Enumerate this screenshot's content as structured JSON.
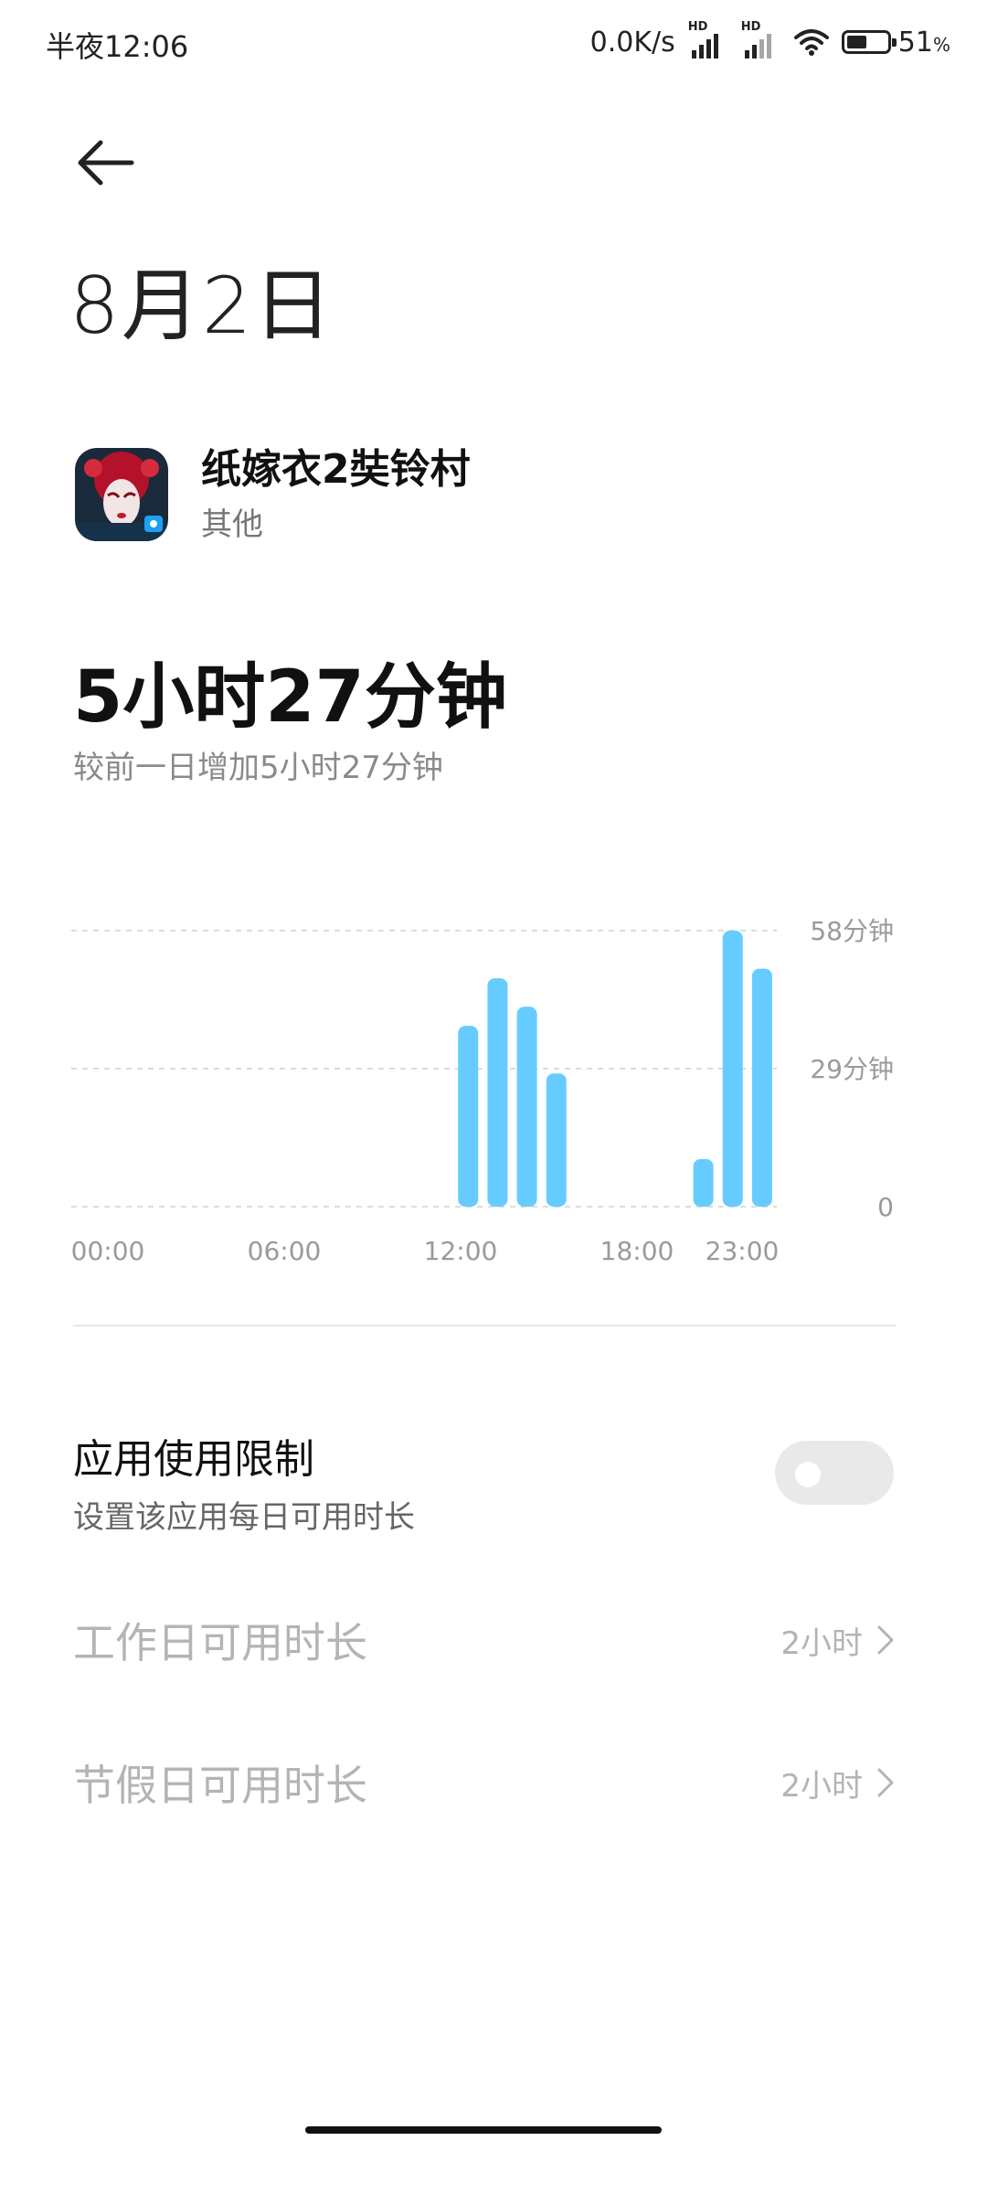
{
  "status_bar": {
    "time": "半夜12:06",
    "net_speed": "0.0K/s",
    "sim1_tag": "HD",
    "sim2_tag": "HD",
    "battery_pct": "51",
    "battery_unit": "%",
    "battery_level": 0.51
  },
  "header": {
    "date_title": "8月2日"
  },
  "app": {
    "name": "纸嫁衣2奘铃村",
    "category": "其他"
  },
  "usage": {
    "total": "5小时27分钟",
    "compare": "较前一日增加5小时27分钟"
  },
  "chart_data": {
    "type": "bar",
    "x_labels": [
      "00:00",
      "06:00",
      "12:00",
      "18:00",
      "23:00"
    ],
    "y_ticks": [
      "58分钟",
      "29分钟",
      "0"
    ],
    "ylim": [
      0,
      58
    ],
    "grid": true,
    "bar_color": "#66CCFF",
    "hours": [
      0,
      1,
      2,
      3,
      4,
      5,
      6,
      7,
      8,
      9,
      10,
      11,
      12,
      13,
      14,
      15,
      16,
      17,
      18,
      19,
      20,
      21,
      22,
      23
    ],
    "values": [
      0,
      0,
      0,
      0,
      0,
      0,
      0,
      0,
      0,
      0,
      0,
      0,
      0,
      38,
      48,
      42,
      28,
      0,
      0,
      0,
      0,
      10,
      58,
      50,
      50
    ]
  },
  "limit": {
    "title": "应用使用限制",
    "subtitle": "设置该应用每日可用时长",
    "enabled": false
  },
  "rows": [
    {
      "label": "工作日可用时长",
      "value": "2小时"
    },
    {
      "label": "节假日可用时长",
      "value": "2小时"
    }
  ]
}
